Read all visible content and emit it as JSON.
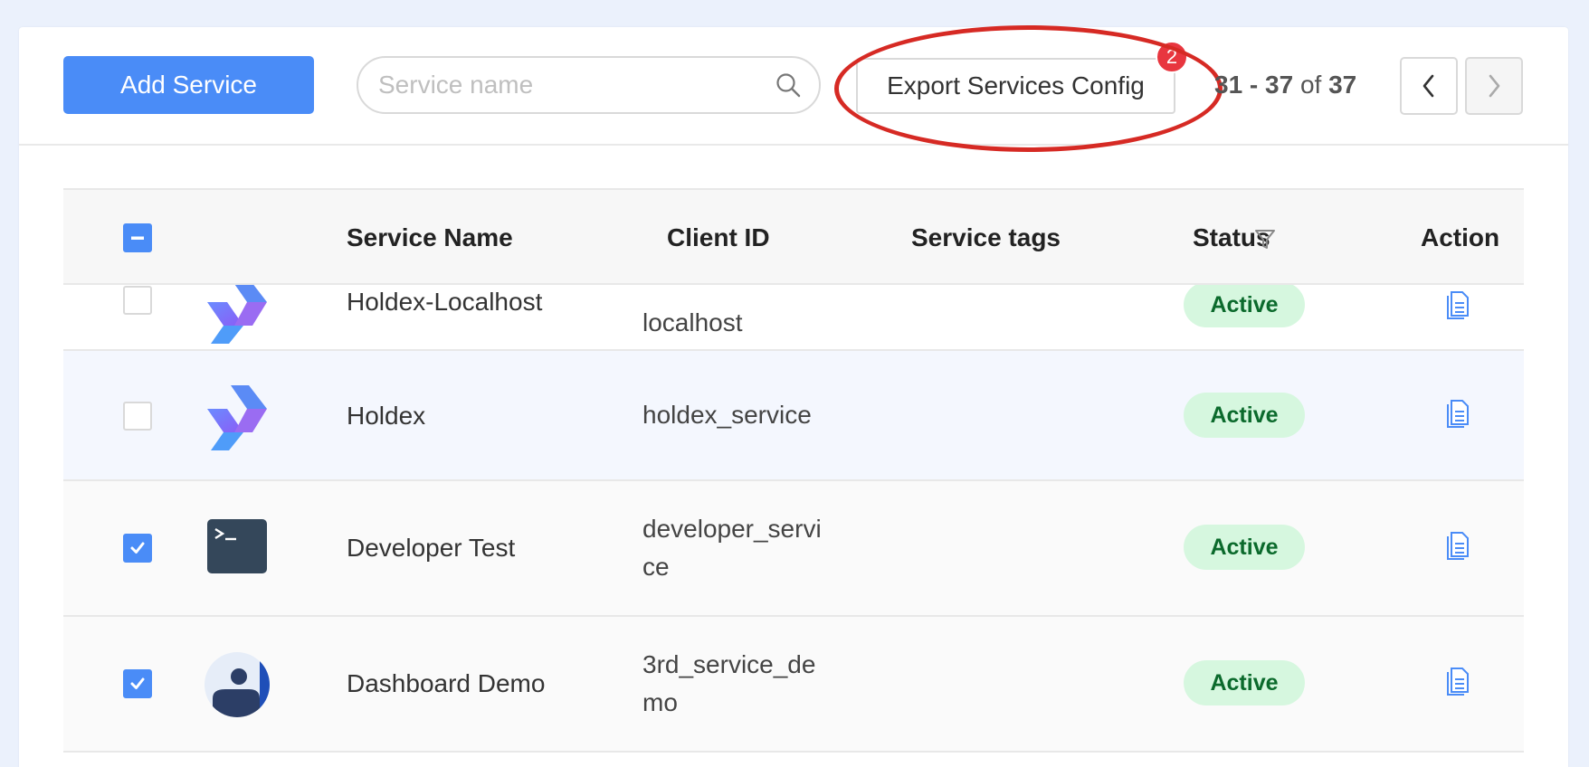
{
  "toolbar": {
    "add_label": "Add Service",
    "search_placeholder": "Service name",
    "export_label": "Export Services Config",
    "badge_count": "2",
    "pager": {
      "range": "31 - 37",
      "of": "of",
      "total": "37"
    }
  },
  "table": {
    "headers": {
      "name": "Service Name",
      "client_id": "Client ID",
      "tags": "Service tags",
      "status": "Status",
      "action": "Action"
    },
    "rows": [
      {
        "name": "Holdex-Localhost",
        "client_id": "localhost",
        "tags": "",
        "status": "Active",
        "checked": false,
        "logo": "holdex-logo"
      },
      {
        "name": "Holdex",
        "client_id": "holdex_service",
        "tags": "",
        "status": "Active",
        "checked": false,
        "logo": "holdex-logo"
      },
      {
        "name": "Developer Test",
        "client_id": "developer_service",
        "tags": "",
        "status": "Active",
        "checked": true,
        "logo": "terminal-logo"
      },
      {
        "name": "Dashboard Demo",
        "client_id": "3rd_service_demo",
        "tags": "",
        "status": "Active",
        "checked": true,
        "logo": "avatar-logo"
      }
    ]
  },
  "colors": {
    "primary": "#4a8cf7",
    "annotation": "#d62a24",
    "badge": "#e8363f",
    "status_bg": "#d6f7df",
    "status_text": "#0b6a2c",
    "page_bg": "#ebf1fc"
  }
}
